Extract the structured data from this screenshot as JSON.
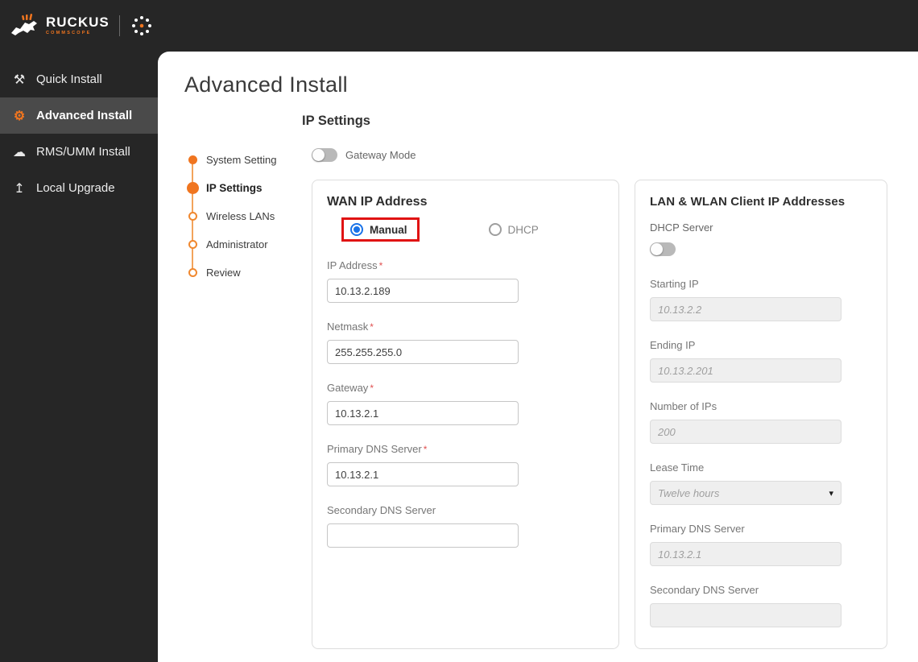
{
  "brand": {
    "name": "RUCKUS",
    "subname": "COMMSCOPE"
  },
  "sidebar": {
    "items": [
      {
        "label": "Quick Install",
        "icon": "tools-icon",
        "active": false
      },
      {
        "label": "Advanced Install",
        "icon": "gear-icon",
        "active": true
      },
      {
        "label": "RMS/UMM Install",
        "icon": "cloud-icon",
        "active": false
      },
      {
        "label": "Local Upgrade",
        "icon": "upload-icon",
        "active": false
      }
    ]
  },
  "page": {
    "title": "Advanced Install"
  },
  "stepper": {
    "steps": [
      {
        "label": "System Setting",
        "state": "completed"
      },
      {
        "label": "IP Settings",
        "state": "current"
      },
      {
        "label": "Wireless LANs",
        "state": "upcoming"
      },
      {
        "label": "Administrator",
        "state": "upcoming"
      },
      {
        "label": "Review",
        "state": "upcoming"
      }
    ]
  },
  "ip_settings": {
    "heading": "IP Settings",
    "gateway_mode": {
      "label": "Gateway Mode",
      "enabled": false
    }
  },
  "wan": {
    "title": "WAN IP Address",
    "required_marker": "*",
    "mode_options": [
      {
        "label": "Manual",
        "selected": true,
        "annotated": true
      },
      {
        "label": "DHCP",
        "selected": false,
        "annotated": false
      }
    ],
    "fields": [
      {
        "label": "IP Address",
        "required": true,
        "value": "10.13.2.189"
      },
      {
        "label": "Netmask",
        "required": true,
        "value": "255.255.255.0"
      },
      {
        "label": "Gateway",
        "required": true,
        "value": "10.13.2.1"
      },
      {
        "label": "Primary DNS Server",
        "required": true,
        "value": "10.13.2.1"
      },
      {
        "label": "Secondary DNS Server",
        "required": false,
        "value": ""
      }
    ]
  },
  "lan": {
    "title": "LAN & WLAN Client IP Addresses",
    "dhcp_server": {
      "label": "DHCP Server",
      "enabled": false
    },
    "fields": [
      {
        "label": "Starting IP",
        "value": "10.13.2.2",
        "disabled": true,
        "control": "input"
      },
      {
        "label": "Ending IP",
        "value": "10.13.2.201",
        "disabled": true,
        "control": "input"
      },
      {
        "label": "Number of IPs",
        "value": "200",
        "disabled": true,
        "control": "input"
      },
      {
        "label": "Lease Time",
        "value": "Twelve hours",
        "disabled": true,
        "control": "select"
      },
      {
        "label": "Primary DNS Server",
        "value": "10.13.2.1",
        "disabled": true,
        "control": "input"
      },
      {
        "label": "Secondary DNS Server",
        "value": "",
        "disabled": true,
        "control": "input"
      }
    ],
    "select_caret": "▾"
  },
  "colors": {
    "accent_orange": "#F0751F",
    "radio_blue": "#1A73E8",
    "annotation_red": "#E01313",
    "sidebar_dark": "#262626"
  }
}
